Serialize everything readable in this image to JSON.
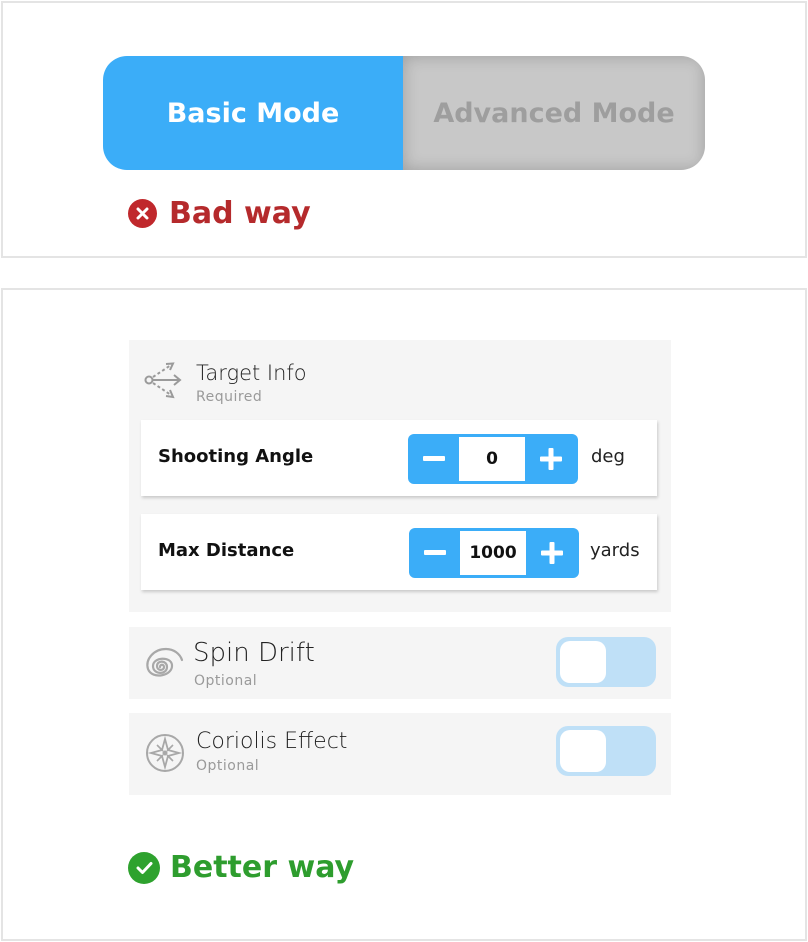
{
  "bad_example": {
    "mode_toggle": {
      "basic_label": "Basic Mode",
      "advanced_label": "Advanced Mode",
      "selected": "Basic Mode"
    },
    "verdict_label": "Bad way",
    "verdict_icon": "x-circle-icon"
  },
  "good_example": {
    "target_info": {
      "title": "Target Info",
      "subtitle": "Required",
      "icon": "target-arrows-icon",
      "fields": [
        {
          "label": "Shooting Angle",
          "value": "0",
          "unit": "deg"
        },
        {
          "label": "Max Distance",
          "value": "1000",
          "unit": "yards"
        }
      ]
    },
    "spin_drift": {
      "title": "Spin Drift",
      "subtitle": "Optional",
      "icon": "spiral-icon",
      "enabled": false
    },
    "coriolis": {
      "title": "Coriolis Effect",
      "subtitle": "Optional",
      "icon": "compass-icon",
      "enabled": false
    },
    "verdict_label": "Better way",
    "verdict_icon": "check-circle-icon"
  },
  "colors": {
    "accent_blue": "#3badf8",
    "toggle_off": "#bfe0f7",
    "bad_red": "#b52a2c",
    "good_green": "#2e9d2e"
  }
}
